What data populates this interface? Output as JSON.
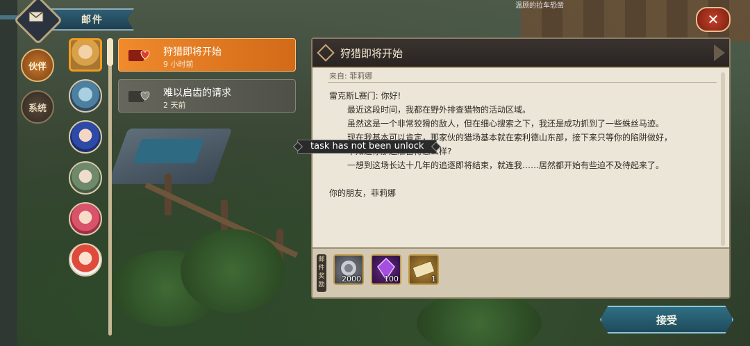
{
  "location_text": "温顾的拉车恐凿",
  "header": {
    "mail_tab_label": "邮件"
  },
  "sidebar": {
    "items": [
      {
        "label": "伙伴"
      },
      {
        "label": "系统"
      }
    ]
  },
  "mail_list": [
    {
      "title": "狩猎即将开始",
      "time": "9 小时前"
    },
    {
      "title": "难以启齿的请求",
      "time": "2 天前"
    }
  ],
  "letter": {
    "title": "狩猎即将开始",
    "from": "来自: 菲莉娜",
    "greeting": "雷克斯L赛门: 你好!",
    "paragraphs": [
      "最近这段时间，我都在野外排查猎物的活动区域。",
      "虽然这是一个非常狡猾的敌人，但在细心搜索之下，我还是成功抓到了一些蛛丝马迹。",
      "现在我基本可以肯定，那家伙的猎场基本就在索利德山东部，接下来只等你的陷阱做好，",
      "不知道你那边准备得怎么样?",
      "一想到这场长达十几年的追逐即将结束，就连我……居然都开始有些迫不及待起来了。"
    ],
    "signature": "你的朋友，菲莉娜"
  },
  "rewards": {
    "label": "邮件奖励",
    "items": [
      {
        "icon": "silver-coin-icon",
        "qty": "2000"
      },
      {
        "icon": "purple-crystal-icon",
        "qty": "100"
      },
      {
        "icon": "ticket-icon",
        "qty": "1"
      }
    ]
  },
  "tooltip": "task has not been unlock",
  "buttons": {
    "accept": "接受",
    "close": "✕"
  }
}
